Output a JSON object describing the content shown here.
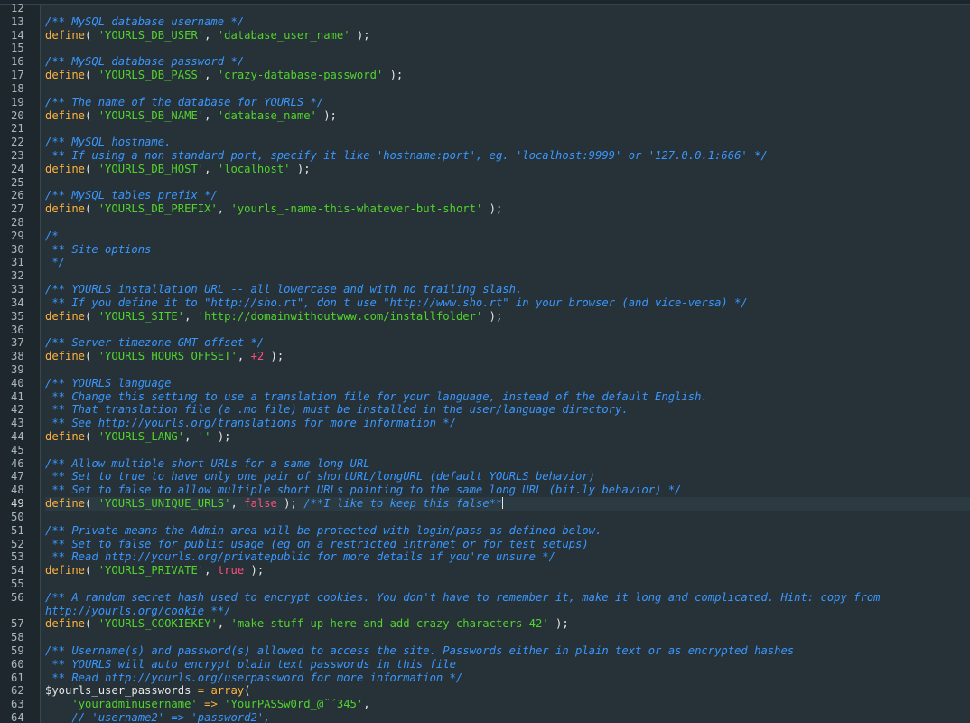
{
  "editor": {
    "lines": [
      {
        "n": "12",
        "tokens": []
      },
      {
        "n": "13",
        "tokens": [
          {
            "t": "com",
            "v": "/** MySQL database username */"
          }
        ]
      },
      {
        "n": "14",
        "tokens": [
          {
            "t": "def",
            "v": "define"
          },
          {
            "t": "pun",
            "v": "( "
          },
          {
            "t": "str",
            "v": "'YOURLS_DB_USER'"
          },
          {
            "t": "pun",
            "v": ", "
          },
          {
            "t": "str",
            "v": "'database_user_name'"
          },
          {
            "t": "pun",
            "v": " );"
          }
        ]
      },
      {
        "n": "15",
        "tokens": []
      },
      {
        "n": "16",
        "tokens": [
          {
            "t": "com",
            "v": "/** MySQL database password */"
          }
        ]
      },
      {
        "n": "17",
        "tokens": [
          {
            "t": "def",
            "v": "define"
          },
          {
            "t": "pun",
            "v": "( "
          },
          {
            "t": "str",
            "v": "'YOURLS_DB_PASS'"
          },
          {
            "t": "pun",
            "v": ", "
          },
          {
            "t": "str",
            "v": "'crazy-database-password'"
          },
          {
            "t": "pun",
            "v": " );"
          }
        ]
      },
      {
        "n": "18",
        "tokens": []
      },
      {
        "n": "19",
        "tokens": [
          {
            "t": "com",
            "v": "/** The name of the database for YOURLS */"
          }
        ]
      },
      {
        "n": "20",
        "tokens": [
          {
            "t": "def",
            "v": "define"
          },
          {
            "t": "pun",
            "v": "( "
          },
          {
            "t": "str",
            "v": "'YOURLS_DB_NAME'"
          },
          {
            "t": "pun",
            "v": ", "
          },
          {
            "t": "str",
            "v": "'database_name'"
          },
          {
            "t": "pun",
            "v": " );"
          }
        ]
      },
      {
        "n": "21",
        "tokens": []
      },
      {
        "n": "22",
        "tokens": [
          {
            "t": "com",
            "v": "/** MySQL hostname."
          }
        ]
      },
      {
        "n": "23",
        "tokens": [
          {
            "t": "com",
            "v": " ** If using a non standard port, specify it like 'hostname:port', eg. 'localhost:9999' or '127.0.0.1:666' */"
          }
        ]
      },
      {
        "n": "24",
        "tokens": [
          {
            "t": "def",
            "v": "define"
          },
          {
            "t": "pun",
            "v": "( "
          },
          {
            "t": "str",
            "v": "'YOURLS_DB_HOST'"
          },
          {
            "t": "pun",
            "v": ", "
          },
          {
            "t": "str",
            "v": "'localhost'"
          },
          {
            "t": "pun",
            "v": " );"
          }
        ]
      },
      {
        "n": "25",
        "tokens": []
      },
      {
        "n": "26",
        "tokens": [
          {
            "t": "com",
            "v": "/** MySQL tables prefix */"
          }
        ]
      },
      {
        "n": "27",
        "tokens": [
          {
            "t": "def",
            "v": "define"
          },
          {
            "t": "pun",
            "v": "( "
          },
          {
            "t": "str",
            "v": "'YOURLS_DB_PREFIX'"
          },
          {
            "t": "pun",
            "v": ", "
          },
          {
            "t": "str",
            "v": "'yourls_-name-this-whatever-but-short'"
          },
          {
            "t": "pun",
            "v": " );"
          }
        ]
      },
      {
        "n": "28",
        "tokens": []
      },
      {
        "n": "29",
        "tokens": [
          {
            "t": "com",
            "v": "/*"
          }
        ]
      },
      {
        "n": "30",
        "tokens": [
          {
            "t": "com",
            "v": " ** Site options"
          }
        ]
      },
      {
        "n": "31",
        "tokens": [
          {
            "t": "com",
            "v": " */"
          }
        ]
      },
      {
        "n": "32",
        "tokens": []
      },
      {
        "n": "33",
        "tokens": [
          {
            "t": "com",
            "v": "/** YOURLS installation URL -- all lowercase and with no trailing slash."
          }
        ]
      },
      {
        "n": "34",
        "tokens": [
          {
            "t": "com",
            "v": " ** If you define it to \"http://sho.rt\", don't use \"http://www.sho.rt\" in your browser (and vice-versa) */"
          }
        ]
      },
      {
        "n": "35",
        "tokens": [
          {
            "t": "def",
            "v": "define"
          },
          {
            "t": "pun",
            "v": "( "
          },
          {
            "t": "str",
            "v": "'YOURLS_SITE'"
          },
          {
            "t": "pun",
            "v": ", "
          },
          {
            "t": "str",
            "v": "'http://domainwithoutwww.com/installfolder'"
          },
          {
            "t": "pun",
            "v": " );"
          }
        ]
      },
      {
        "n": "36",
        "tokens": []
      },
      {
        "n": "37",
        "tokens": [
          {
            "t": "com",
            "v": "/** Server timezone GMT offset */"
          }
        ]
      },
      {
        "n": "38",
        "tokens": [
          {
            "t": "def",
            "v": "define"
          },
          {
            "t": "pun",
            "v": "( "
          },
          {
            "t": "str",
            "v": "'YOURLS_HOURS_OFFSET'"
          },
          {
            "t": "pun",
            "v": ", "
          },
          {
            "t": "num",
            "v": "+2"
          },
          {
            "t": "pun",
            "v": " );"
          }
        ]
      },
      {
        "n": "39",
        "tokens": []
      },
      {
        "n": "40",
        "tokens": [
          {
            "t": "com",
            "v": "/** YOURLS language"
          }
        ]
      },
      {
        "n": "41",
        "tokens": [
          {
            "t": "com",
            "v": " ** Change this setting to use a translation file for your language, instead of the default English."
          }
        ]
      },
      {
        "n": "42",
        "tokens": [
          {
            "t": "com",
            "v": " ** That translation file (a .mo file) must be installed in the user/language directory."
          }
        ]
      },
      {
        "n": "43",
        "tokens": [
          {
            "t": "com",
            "v": " ** See http://yourls.org/translations for more information */"
          }
        ]
      },
      {
        "n": "44",
        "tokens": [
          {
            "t": "def",
            "v": "define"
          },
          {
            "t": "pun",
            "v": "( "
          },
          {
            "t": "str",
            "v": "'YOURLS_LANG'"
          },
          {
            "t": "pun",
            "v": ", "
          },
          {
            "t": "str",
            "v": "''"
          },
          {
            "t": "pun",
            "v": " );"
          }
        ]
      },
      {
        "n": "45",
        "tokens": []
      },
      {
        "n": "46",
        "tokens": [
          {
            "t": "com",
            "v": "/** Allow multiple short URLs for a same long URL"
          }
        ]
      },
      {
        "n": "47",
        "tokens": [
          {
            "t": "com",
            "v": " ** Set to true to have only one pair of shortURL/longURL (default YOURLS behavior)"
          }
        ]
      },
      {
        "n": "48",
        "tokens": [
          {
            "t": "com",
            "v": " ** Set to false to allow multiple short URLs pointing to the same long URL (bit.ly behavior) */"
          }
        ]
      },
      {
        "n": "49",
        "current": true,
        "tokens": [
          {
            "t": "def",
            "v": "define"
          },
          {
            "t": "pun",
            "v": "( "
          },
          {
            "t": "str",
            "v": "'YOURLS_UNIQUE_URLS'"
          },
          {
            "t": "pun",
            "v": ", "
          },
          {
            "t": "bool",
            "v": "false"
          },
          {
            "t": "pun",
            "v": " ); "
          },
          {
            "t": "com",
            "v": "/**I like to keep this false**"
          },
          {
            "t": "cursor",
            "v": ""
          }
        ]
      },
      {
        "n": "50",
        "tokens": []
      },
      {
        "n": "51",
        "tokens": [
          {
            "t": "com",
            "v": "/** Private means the Admin area will be protected with login/pass as defined below."
          }
        ]
      },
      {
        "n": "52",
        "tokens": [
          {
            "t": "com",
            "v": " ** Set to false for public usage (eg on a restricted intranet or for test setups)"
          }
        ]
      },
      {
        "n": "53",
        "tokens": [
          {
            "t": "com",
            "v": " ** Read http://yourls.org/privatepublic for more details if you're unsure */"
          }
        ]
      },
      {
        "n": "54",
        "tokens": [
          {
            "t": "def",
            "v": "define"
          },
          {
            "t": "pun",
            "v": "( "
          },
          {
            "t": "str",
            "v": "'YOURLS_PRIVATE'"
          },
          {
            "t": "pun",
            "v": ", "
          },
          {
            "t": "bool",
            "v": "true"
          },
          {
            "t": "pun",
            "v": " );"
          }
        ]
      },
      {
        "n": "55",
        "tokens": []
      },
      {
        "n": "56",
        "tokens": [
          {
            "t": "com",
            "v": "/** A random secret hash used to encrypt cookies. You don't have to remember it, make it long and complicated. Hint: copy from"
          }
        ]
      },
      {
        "n": "",
        "tokens": [
          {
            "t": "com",
            "v": "http://yourls.org/cookie **/"
          }
        ]
      },
      {
        "n": "57",
        "tokens": [
          {
            "t": "def",
            "v": "define"
          },
          {
            "t": "pun",
            "v": "( "
          },
          {
            "t": "str",
            "v": "'YOURLS_COOKIEKEY'"
          },
          {
            "t": "pun",
            "v": ", "
          },
          {
            "t": "str",
            "v": "'make-stuff-up-here-and-add-crazy-characters-42'"
          },
          {
            "t": "pun",
            "v": " );"
          }
        ]
      },
      {
        "n": "58",
        "tokens": []
      },
      {
        "n": "59",
        "tokens": [
          {
            "t": "com",
            "v": "/** Username(s) and password(s) allowed to access the site. Passwords either in plain text or as encrypted hashes"
          }
        ]
      },
      {
        "n": "60",
        "tokens": [
          {
            "t": "com",
            "v": " ** YOURLS will auto encrypt plain text passwords in this file"
          }
        ]
      },
      {
        "n": "61",
        "tokens": [
          {
            "t": "com",
            "v": " ** Read http://yourls.org/userpassword for more information */"
          }
        ]
      },
      {
        "n": "62",
        "tokens": [
          {
            "t": "var",
            "v": "$yourls_user_passwords"
          },
          {
            "t": "op",
            "v": " = "
          },
          {
            "t": "fn",
            "v": "array"
          },
          {
            "t": "pun",
            "v": "("
          }
        ]
      },
      {
        "n": "63",
        "tokens": [
          {
            "t": "pun",
            "v": "    "
          },
          {
            "t": "str",
            "v": "'youradminusername'"
          },
          {
            "t": "op",
            "v": " => "
          },
          {
            "t": "str",
            "v": "'YourPASSw0rd_@˜´345'"
          },
          {
            "t": "pun",
            "v": ","
          }
        ]
      },
      {
        "n": "64",
        "tokens": [
          {
            "t": "pun",
            "v": "    "
          },
          {
            "t": "com",
            "v": "// 'username2' => 'password2',"
          }
        ]
      }
    ]
  }
}
